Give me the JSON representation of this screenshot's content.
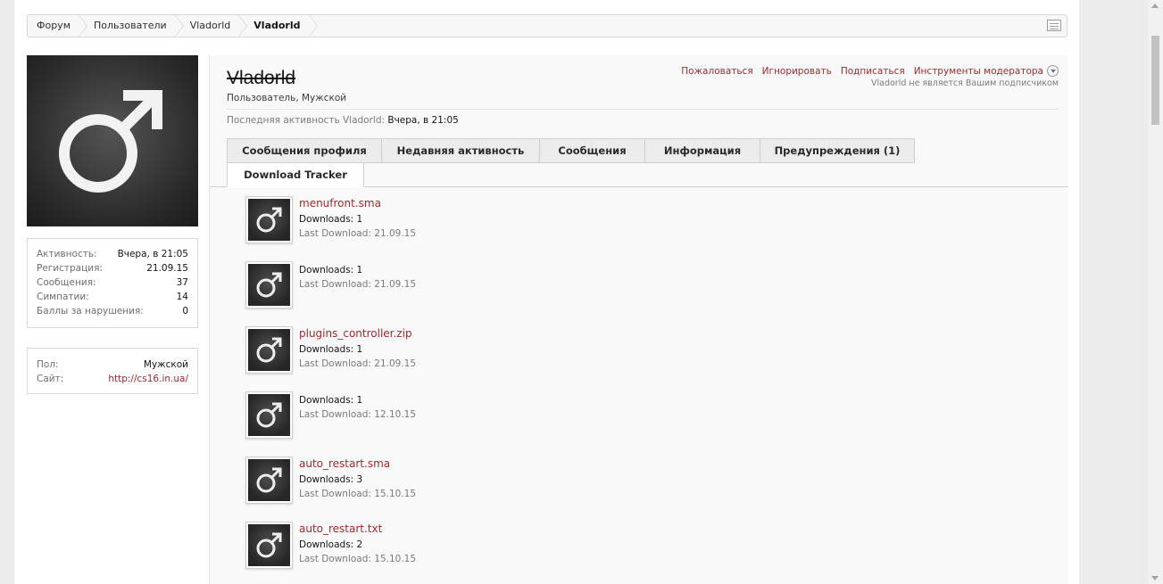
{
  "breadcrumb": {
    "items": [
      "Форум",
      "Пользователи",
      "Vladorld",
      "Vladorld"
    ]
  },
  "profile": {
    "username": "Vladorld",
    "title": "Пользователь, Мужской",
    "last_activity_label": "Последняя активность Vladorld:",
    "last_activity_value": "Вчера, в 21:05",
    "actions": [
      "Пожаловаться",
      "Игнорировать",
      "Подписаться",
      "Инструменты модератора"
    ],
    "follow_note": "Vladorld не является Вашим подписчиком"
  },
  "stats": [
    {
      "label": "Активность:",
      "value": "Вчера, в 21:05"
    },
    {
      "label": "Регистрация:",
      "value": "21.09.15"
    },
    {
      "label": "Сообщения:",
      "value": "37"
    },
    {
      "label": "Симпатии:",
      "value": "14"
    },
    {
      "label": "Баллы за нарушения:",
      "value": "0"
    }
  ],
  "info": [
    {
      "label": "Пол:",
      "value": "Мужской"
    },
    {
      "label": "Сайт:",
      "value": "http://cs16.in.ua/"
    }
  ],
  "tabs": [
    "Сообщения профиля",
    "Недавняя активность",
    "Сообщения",
    "Информация",
    "Предупреждения (1)",
    "Download Tracker"
  ],
  "active_tab": "Download Tracker",
  "downloads": [
    {
      "name": "menufront.sma",
      "downloads": "Downloads: 1",
      "last": "Last Download: 21.09.15"
    },
    {
      "name": "",
      "downloads": "Downloads: 1",
      "last": "Last Download: 21.09.15"
    },
    {
      "name": "plugins_controller.zip",
      "downloads": "Downloads: 1",
      "last": "Last Download: 21.09.15"
    },
    {
      "name": "",
      "downloads": "Downloads: 1",
      "last": "Last Download: 12.10.15"
    },
    {
      "name": "auto_restart.sma",
      "downloads": "Downloads: 3",
      "last": "Last Download: 15.10.15"
    },
    {
      "name": "auto_restart.txt",
      "downloads": "Downloads: 2",
      "last": "Last Download: 15.10.15"
    }
  ],
  "colors": {
    "link": "#9e2a2a",
    "avatar_bg": "#2a2a2a"
  },
  "icons": [
    "male-symbol-icon",
    "jump-menu-icon",
    "dropdown-caret-icon"
  ]
}
